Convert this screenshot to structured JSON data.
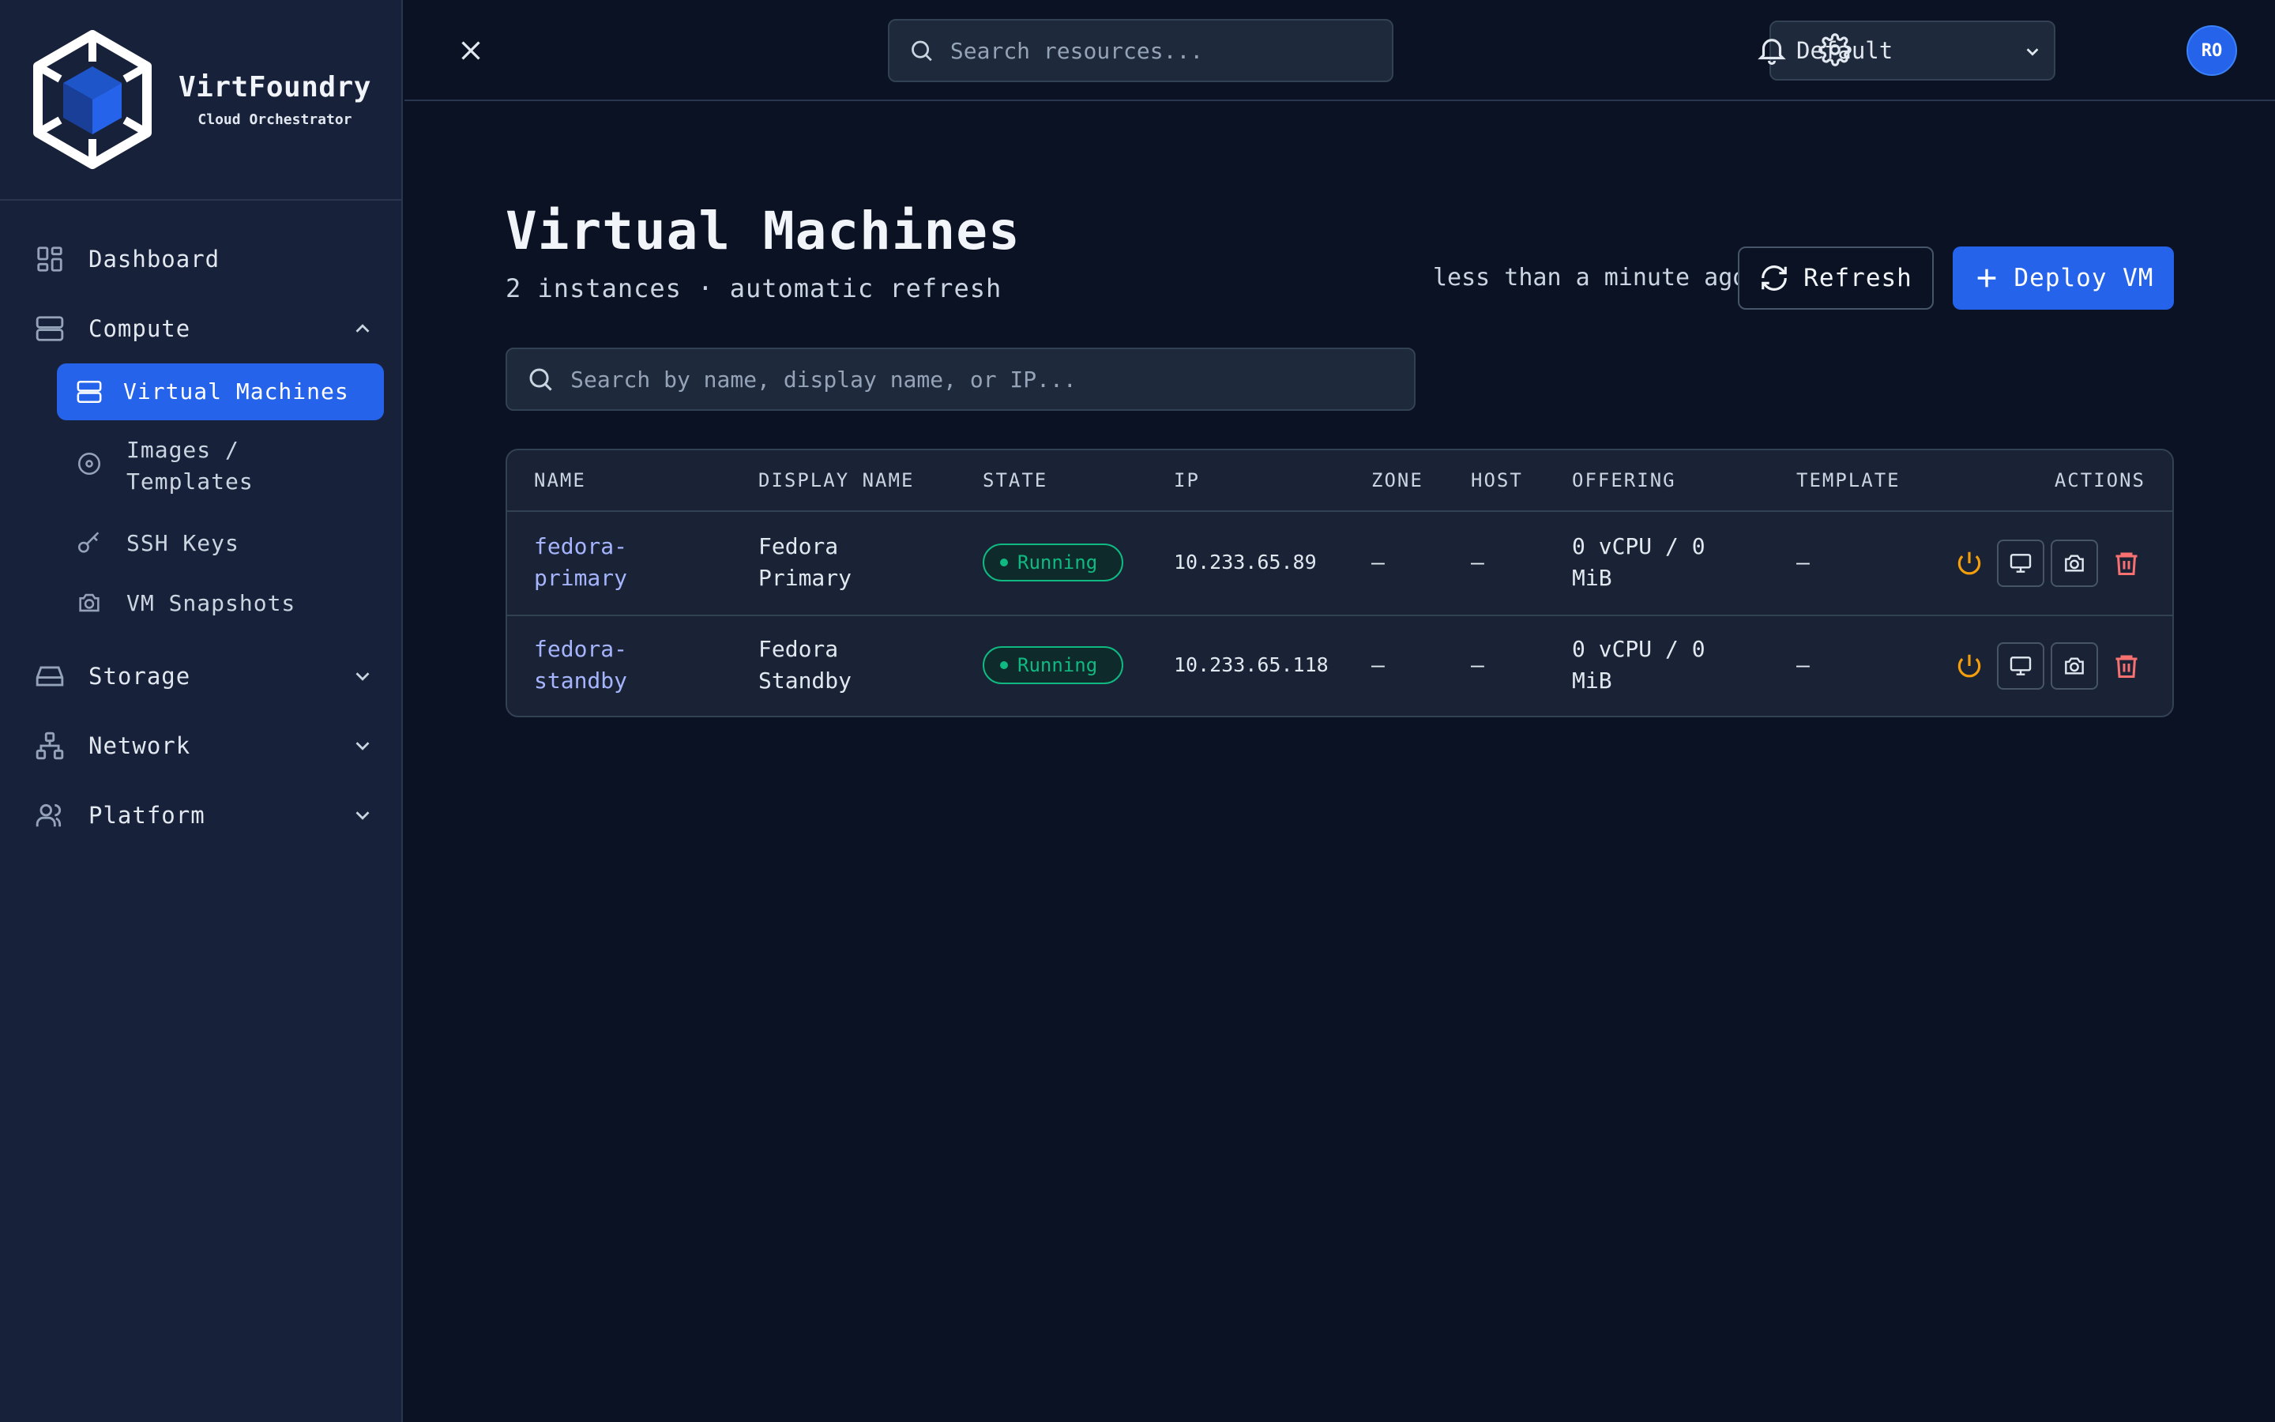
{
  "brand": {
    "name": "VirtFoundry",
    "subtitle": "Cloud Orchestrator"
  },
  "nav": {
    "dashboard": "Dashboard",
    "compute": "Compute",
    "compute_items": [
      "Virtual Machines",
      "Images /",
      "Templates",
      "SSH Keys",
      "VM Snapshots"
    ],
    "storage": "Storage",
    "network": "Network",
    "platform": "Platform"
  },
  "topbar": {
    "search_placeholder": "Search resources...",
    "project": "Default",
    "avatar": "RO"
  },
  "page": {
    "title": "Virtual Machines",
    "subtitle": "2 instances · automatic refresh",
    "updated": "less than a minute ago",
    "refresh_label": "Refresh",
    "deploy_label": "Deploy VM",
    "search_placeholder": "Search by name, display name, or IP..."
  },
  "table": {
    "columns": [
      "NAME",
      "DISPLAY NAME",
      "STATE",
      "IP",
      "ZONE",
      "HOST",
      "OFFERING",
      "TEMPLATE",
      "ACTIONS"
    ],
    "rows": [
      {
        "name_l1": "fedora-",
        "name_l2": "primary",
        "display_l1": "Fedora",
        "display_l2": "Primary",
        "state": "Running",
        "ip": "10.233.65.89",
        "zone": "—",
        "host": "—",
        "offering_l1": "0 vCPU / 0",
        "offering_l2": "MiB",
        "template": "—"
      },
      {
        "name_l1": "fedora-",
        "name_l2": "standby",
        "display_l1": "Fedora",
        "display_l2": "Standby",
        "state": "Running",
        "ip": "10.233.65.118",
        "zone": "—",
        "host": "—",
        "offering_l1": "0 vCPU / 0",
        "offering_l2": "MiB",
        "template": "—"
      }
    ]
  },
  "colors": {
    "accent": "#2563eb",
    "running": "#10b981",
    "power": "#f59e0b",
    "delete": "#f87171",
    "link": "#a5b4fc"
  },
  "icons": [
    "logo-cube-icon",
    "dashboard-icon",
    "server-icon",
    "disc-icon",
    "key-icon",
    "camera-icon",
    "hard-drive-icon",
    "network-icon",
    "users-icon",
    "chevron-up-icon",
    "chevron-down-icon",
    "close-icon",
    "search-icon",
    "bell-icon",
    "gear-icon",
    "refresh-icon",
    "plus-icon",
    "power-icon",
    "console-icon",
    "snapshot-icon",
    "trash-icon"
  ]
}
